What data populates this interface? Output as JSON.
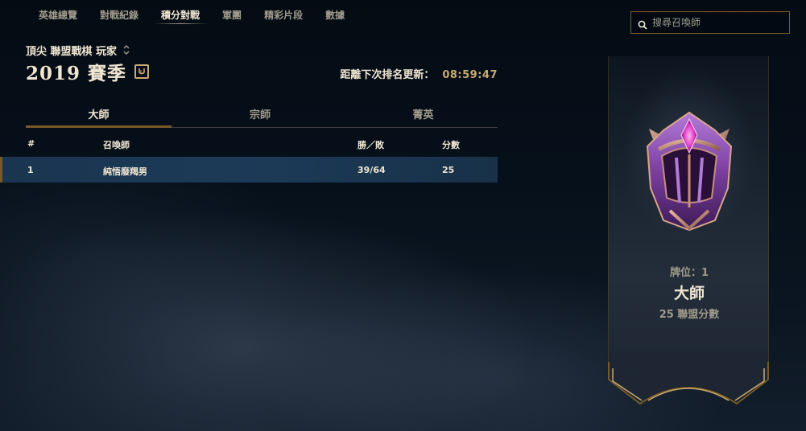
{
  "nav": {
    "items": [
      {
        "label": "英雄總覽",
        "active": false
      },
      {
        "label": "對戰紀錄",
        "active": false
      },
      {
        "label": "積分對戰",
        "active": true
      },
      {
        "label": "軍團",
        "active": false
      },
      {
        "label": "精彩片段",
        "active": false
      },
      {
        "label": "數據",
        "active": false
      }
    ]
  },
  "header": {
    "queue_label": "頂尖 聯盟戰棋 玩家",
    "season_title": "2019 賽季",
    "timer_label": "距離下次排名更新：",
    "timer_value": "08:59:47"
  },
  "tier_tabs": [
    {
      "label": "大師",
      "active": true
    },
    {
      "label": "宗師",
      "active": false
    },
    {
      "label": "菁英",
      "active": false
    }
  ],
  "table": {
    "headers": {
      "rank": "#",
      "name": "召喚師",
      "wl": "勝／敗",
      "lp": "分數"
    },
    "rows": [
      {
        "rank": "1",
        "name": "純悟廢羯男",
        "wl": "39/64",
        "lp": "25"
      }
    ]
  },
  "search": {
    "placeholder": "搜尋召喚師",
    "value": ""
  },
  "banner": {
    "rank_text": "牌位：1",
    "tier_text": "大師",
    "lp_text": "25 聯盟分數",
    "emblem_icon": "master-emblem-icon"
  },
  "colors": {
    "gold": "#c8aa6e",
    "dark_gold": "#785a28",
    "text_light": "#f0e6d2",
    "text_dim": "#a09b8c",
    "row_highlight": "#1c3a57",
    "emblem_purple": "#8a4fb0",
    "emblem_pink": "#e040c8"
  }
}
